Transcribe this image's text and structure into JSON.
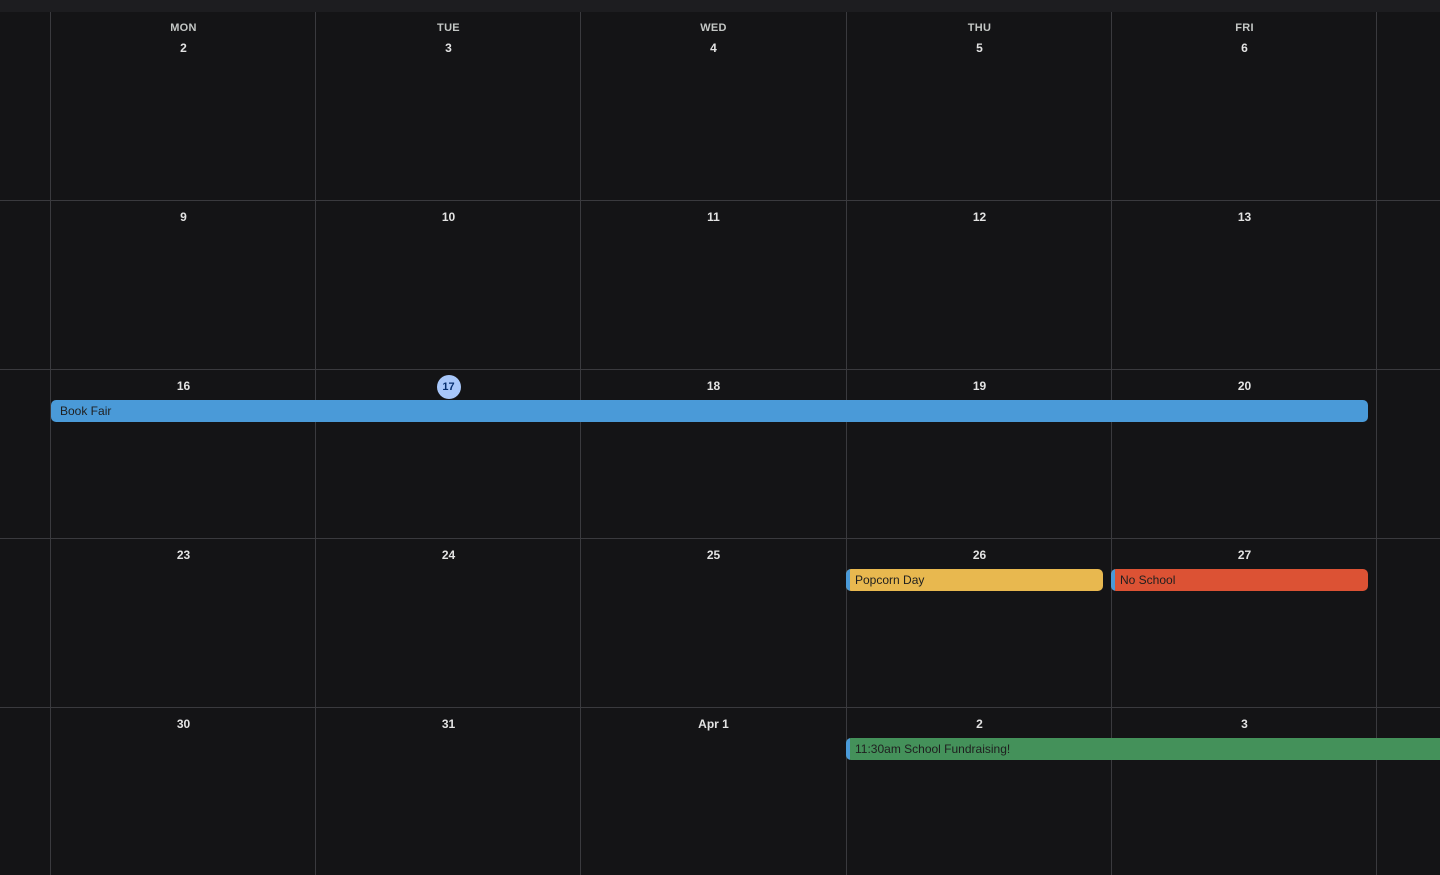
{
  "weekdays": [
    "MON",
    "TUE",
    "WED",
    "THU",
    "FRI"
  ],
  "weeks": [
    [
      "2",
      "3",
      "4",
      "5",
      "6"
    ],
    [
      "9",
      "10",
      "11",
      "12",
      "13"
    ],
    [
      "16",
      "17",
      "18",
      "19",
      "20"
    ],
    [
      "23",
      "24",
      "25",
      "26",
      "27"
    ],
    [
      "30",
      "31",
      "Apr 1",
      "2",
      "3"
    ]
  ],
  "today": "17",
  "events": {
    "book_fair": {
      "title": "Book Fair",
      "color": "#4a9ad8"
    },
    "popcorn_day": {
      "title": "Popcorn Day",
      "color": "#e8b84f",
      "edge_color": "#4a9ad8"
    },
    "no_school": {
      "title": "No School",
      "color": "#dc5234",
      "edge_color": "#4a9ad8"
    },
    "fundraising": {
      "title": "11:30am School Fundraising!",
      "color": "#44915a",
      "edge_color": "#4a9ad8"
    }
  }
}
